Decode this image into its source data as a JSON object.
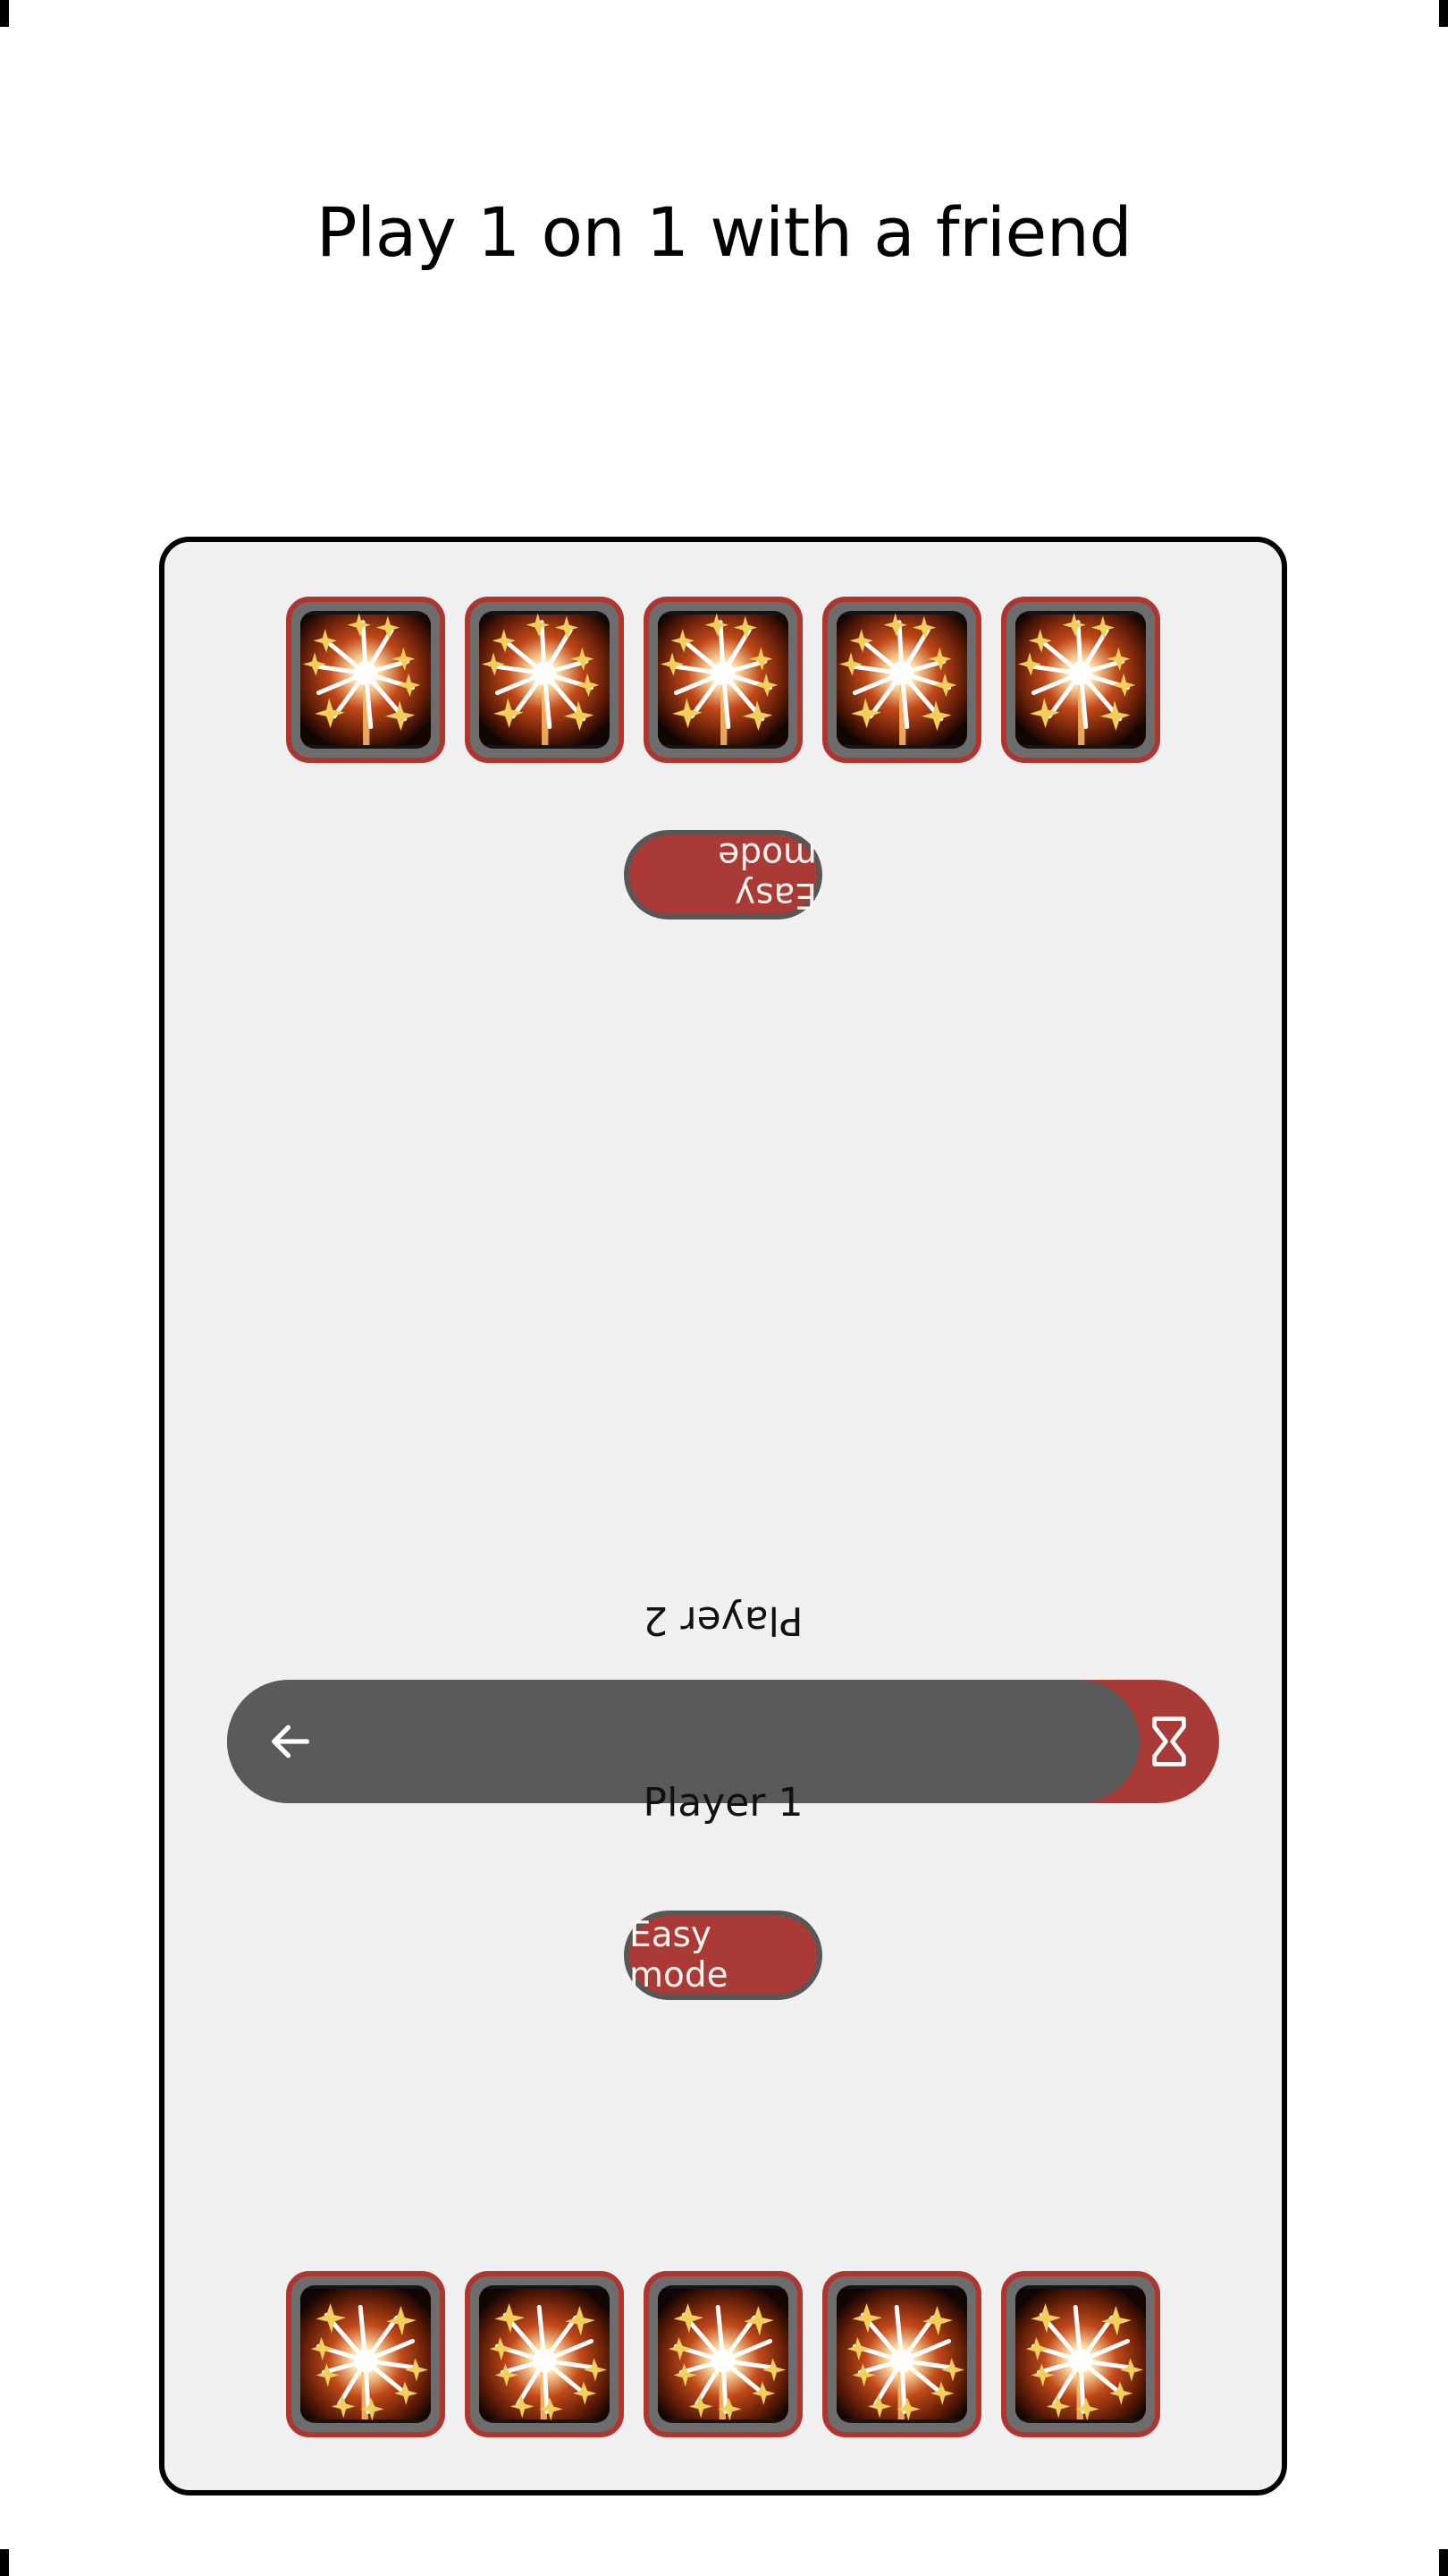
{
  "page": {
    "title": "Play 1 on 1 with a friend"
  },
  "colors": {
    "accent_red": "#a93a36",
    "card_border_red": "#b0352f",
    "timer_gray": "#5b5a5a",
    "board_bg": "#f0f0f0",
    "board_border": "#000000",
    "button_border_gray": "#575757",
    "icon_tile_gray": "#6d6d6d"
  },
  "board": {
    "player_two": {
      "label": "Player 2",
      "mode_button": "Easy mode",
      "sparkler_icons": [
        {
          "name": "sparkler-icon",
          "count_index": 1
        },
        {
          "name": "sparkler-icon",
          "count_index": 2
        },
        {
          "name": "sparkler-icon",
          "count_index": 3
        },
        {
          "name": "sparkler-icon",
          "count_index": 4
        },
        {
          "name": "sparkler-icon",
          "count_index": 5
        }
      ],
      "sparkler_count": 5
    },
    "player_one": {
      "label": "Player 1",
      "mode_button": "Easy mode",
      "sparkler_icons": [
        {
          "name": "sparkler-icon",
          "count_index": 1
        },
        {
          "name": "sparkler-icon",
          "count_index": 2
        },
        {
          "name": "sparkler-icon",
          "count_index": 3
        },
        {
          "name": "sparkler-icon",
          "count_index": 4
        },
        {
          "name": "sparkler-icon",
          "count_index": 5
        }
      ],
      "sparkler_count": 5
    },
    "timer": {
      "back_icon": "arrow-left-icon",
      "hourglass_icon": "hourglass-icon",
      "fill_percent": 92
    }
  }
}
